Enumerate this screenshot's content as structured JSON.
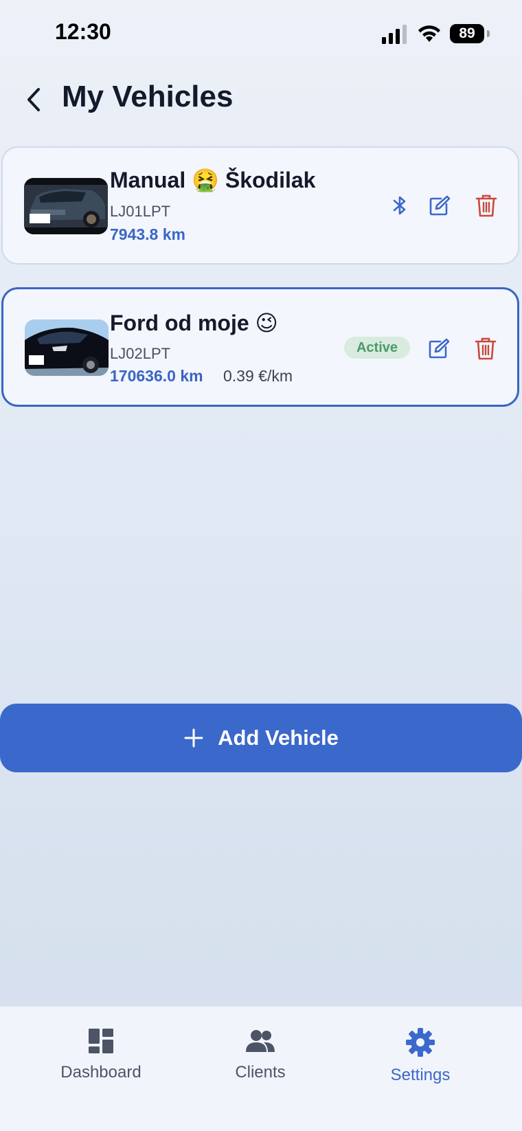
{
  "status_bar": {
    "time": "12:30",
    "battery": "89"
  },
  "header": {
    "title": "My Vehicles"
  },
  "vehicles": [
    {
      "name": "Manual 🤮 Škodilak",
      "plate": "LJ01LPT",
      "odometer": "7943.8 km",
      "rate": "",
      "active": false
    },
    {
      "name": "Ford od  moje 😉",
      "plate": "LJ02LPT",
      "odometer": "170636.0 km",
      "rate": "0.39 €/km",
      "active": true,
      "badge": "Active"
    }
  ],
  "add_button": {
    "label": "Add Vehicle"
  },
  "tabs": [
    {
      "label": "Dashboard",
      "icon": "dashboard-icon",
      "selected": false
    },
    {
      "label": "Clients",
      "icon": "people-icon",
      "selected": false
    },
    {
      "label": "Settings",
      "icon": "gear-icon",
      "selected": true
    }
  ],
  "colors": {
    "accent": "#3b68cb",
    "delete": "#c9493d",
    "active_badge_bg": "#d9eadf",
    "active_badge_text": "#4a9a68",
    "title": "#141a2b"
  }
}
